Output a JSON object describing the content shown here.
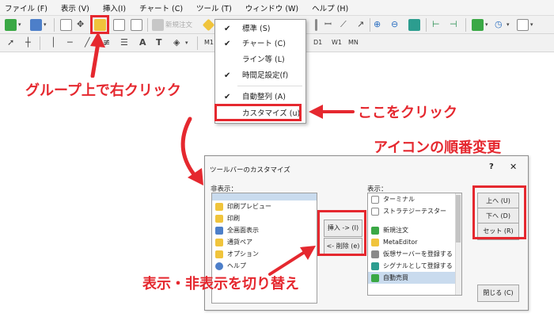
{
  "menubar": {
    "items": [
      "ファイル (F)",
      "表示 (V)",
      "挿入(I)",
      "チャート (C)",
      "ツール (T)",
      "ウィンドウ (W)",
      "ヘルプ (H)"
    ]
  },
  "toolbar": {
    "new_order_label": "新規注文",
    "timeframes": [
      "M1",
      "D1",
      "W1",
      "MN"
    ]
  },
  "context_menu": {
    "items": [
      {
        "label": "標準 (S)",
        "checked": true
      },
      {
        "label": "チャート (C)",
        "checked": true
      },
      {
        "label": "ライン等 (L)",
        "checked": false
      },
      {
        "label": "時間足設定(f)",
        "checked": true
      },
      {
        "label": "自動整列 (A)",
        "checked": true
      },
      {
        "label": "カスタマイズ (u)",
        "checked": false
      }
    ],
    "check_glyph": "✔"
  },
  "annotations": {
    "right_click": "グループ上で右クリック",
    "click_here": "ここをクリック",
    "reorder": "アイコンの順番変更",
    "toggle": "表示・非表示を切り替え"
  },
  "dialog": {
    "title": "ツールバーのカスタマイズ",
    "help": "?",
    "close": "✕",
    "hidden_label": "非表示：",
    "shown_label": "表示：",
    "hidden_items": [
      "印刷プレビュー",
      "印刷",
      "全画面表示",
      "通貨ペア",
      "オプション",
      "ヘルプ"
    ],
    "shown_items": [
      "ターミナル",
      "ストラテジーテスター",
      "新規注文",
      "MetaEditor",
      "仮想サーバーを登録する",
      "シグナルとして登録する",
      "自動売買"
    ],
    "insert_button": "挿入 -> (I)",
    "remove_button": "<- 削除 (e)",
    "up_button": "上へ (U)",
    "down_button": "下へ (D)",
    "reset_button": "セット (R)",
    "close_button": "閉じる (C)"
  },
  "colors": {
    "accent_red": "#e5282f",
    "selection": "#c9dbee"
  }
}
